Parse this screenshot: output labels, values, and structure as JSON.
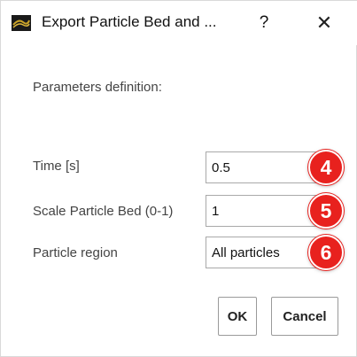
{
  "window": {
    "title": "Export Particle Bed and ...",
    "help_glyph": "?",
    "close_glyph": "✕"
  },
  "form": {
    "section_label": "Parameters definition:",
    "time": {
      "label": "Time [s]",
      "value": "0.5"
    },
    "scale": {
      "label": "Scale Particle Bed (0-1)",
      "value": "1"
    },
    "region": {
      "label": "Particle region",
      "value": "All particles"
    }
  },
  "badges": [
    "4",
    "5",
    "6"
  ],
  "buttons": {
    "ok_label": "OK",
    "cancel_label": "Cancel"
  },
  "colors": {
    "badge": "#e8211e",
    "app_icon": "#c9a227"
  },
  "icons": [
    "app-icon",
    "help-icon",
    "close-icon",
    "chevron-down-icon"
  ]
}
